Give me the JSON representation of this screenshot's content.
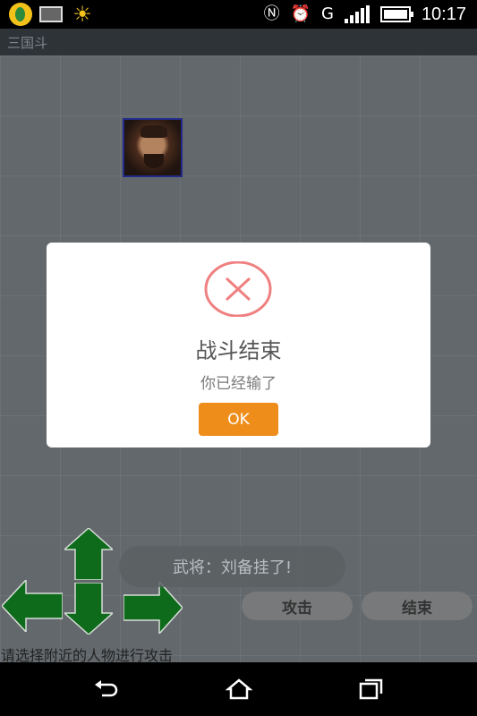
{
  "status_bar": {
    "time": "10:17",
    "icons": [
      "app-badge-icon",
      "image-icon",
      "sun-icon",
      "nfc-icon",
      "alarm-icon",
      "gps-signal-icon",
      "cell-signal-icon",
      "battery-icon"
    ],
    "battery_level": 1.0
  },
  "app_bar": {
    "title": "三国斗"
  },
  "dialog": {
    "icon": "error-x-icon",
    "accent_color": "#f08080",
    "title": "战斗结束",
    "message": "你已经输了",
    "ok_label": "OK",
    "ok_color": "#ef8d1b"
  },
  "game": {
    "portrait_name": "general-portrait-icon",
    "toast": "武将：刘备挂了!",
    "attack_label": "攻击",
    "end_label": "结束",
    "hint": "请选择附近的人物进行攻击",
    "dpad_color": "#0d6b1b"
  },
  "nav_bar": {
    "icons": [
      "back-icon",
      "home-icon",
      "recents-icon"
    ]
  }
}
